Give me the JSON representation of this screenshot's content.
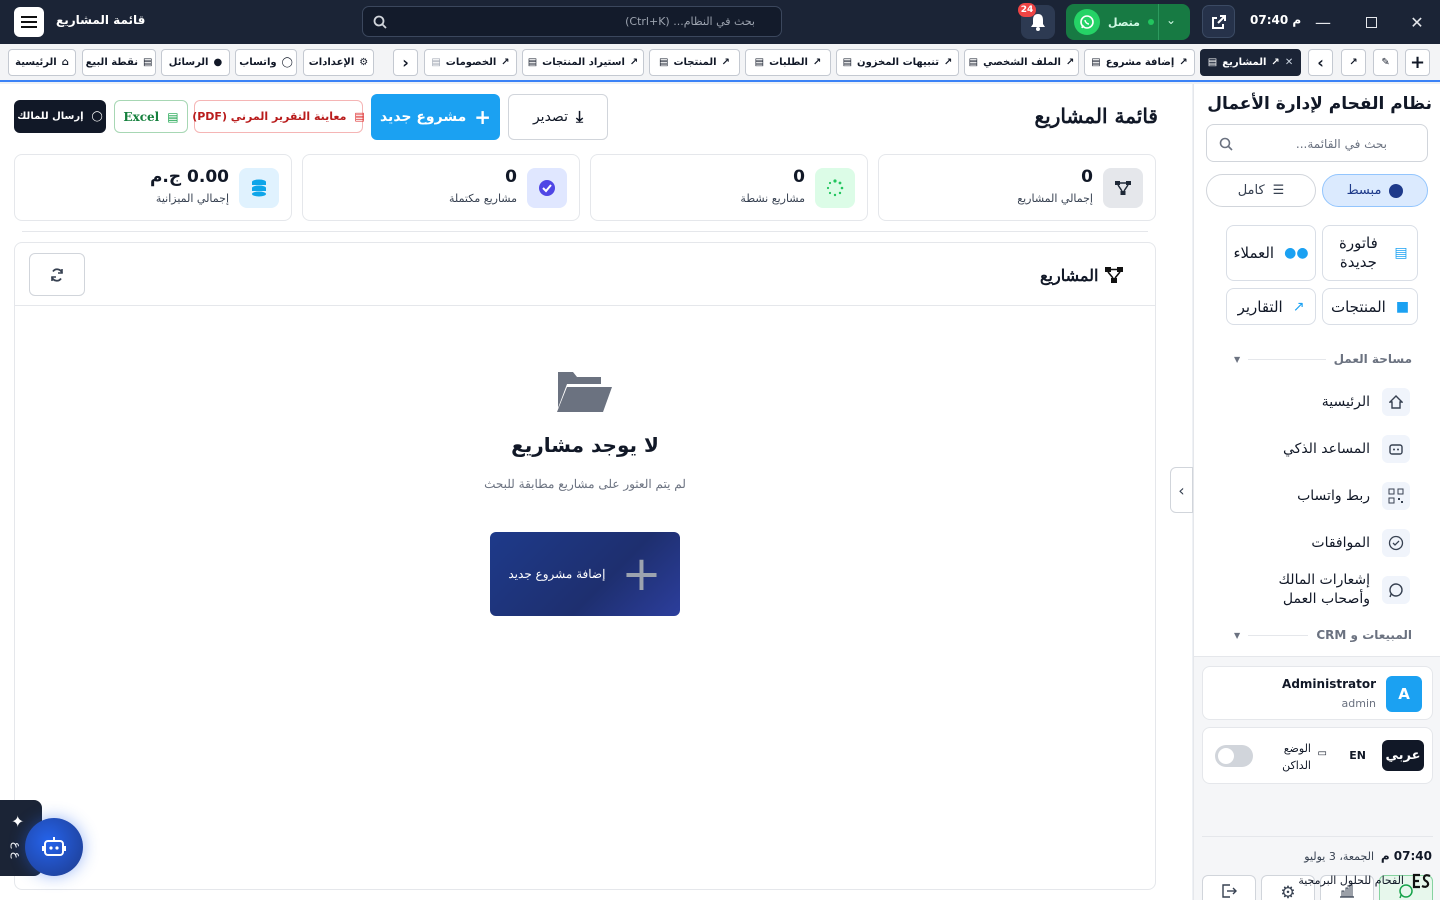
{
  "topbar": {
    "app_title": "قائمة المشاريع",
    "search_placeholder": "بحث في النظام... (Ctrl+K)",
    "notifications_count": "24",
    "whatsapp_status": "متصل",
    "time": "07:40 م"
  },
  "tabs": {
    "active": "المشاريع",
    "open_tabs": [
      "إضافة مشروع",
      "الملف الشخصي",
      "تنبيهات المخزون",
      "الطلبات",
      "المنتجات",
      "استيراد المنتجات",
      "الخصومات"
    ],
    "quick_links": [
      "الإعدادات",
      "واتساب",
      "الرسائل",
      "نقطة البيع",
      "الرئيسية"
    ]
  },
  "page": {
    "title": "قائمة المشاريع",
    "export_label": "تصدير",
    "new_project_label": "مشروع جديد",
    "pdf_label": "معاينة التقرير المرني (PDF)",
    "excel_label": "Excel",
    "send_owner_label": "إرسال للمالك"
  },
  "stats": [
    {
      "value": "0",
      "label": "إجمالي المشاريع",
      "icon": "diagram-icon",
      "color": "#374151",
      "bg": "#e5e7eb"
    },
    {
      "value": "0",
      "label": "مشاريع نشطة",
      "icon": "spinner-icon",
      "color": "#22c55e",
      "bg": "#dcfce7"
    },
    {
      "value": "0",
      "label": "مشاريع مكتملة",
      "icon": "check-circle-icon",
      "color": "#4f46e5",
      "bg": "#e0e7ff"
    },
    {
      "value": "0.00 ج.م",
      "label": "إجمالي الميزانية",
      "icon": "coins-icon",
      "color": "#0ea5e9",
      "bg": "#e0f2fe"
    }
  ],
  "list_section": {
    "title": "المشاريع",
    "empty_title": "لا يوجد مشاريع",
    "empty_subtitle": "لم يتم العثور على مشاريع مطابقة للبحث",
    "add_button": "إضافة مشروع جديد"
  },
  "sidebar": {
    "title": "نظام الفحام لإدارة الأعمال",
    "search_placeholder": "بحث في القائمة...",
    "mode_simple": "مبسط",
    "mode_full": "كامل",
    "quick_actions": [
      "فاتورة جديدة",
      "العملاء",
      "المنتجات",
      "التقارير"
    ],
    "section_workspace": "مساحة العمل",
    "nav_items": [
      "الرئيسية",
      "المساعد الذكي",
      "ربط واتساب",
      "الموافقات",
      "إشعارات المالك وأصحاب العمل"
    ],
    "section_sales": "المبيعات و CRM",
    "user_name": "Administrator",
    "user_role": "admin",
    "avatar_letter": "A",
    "lang_ar": "عربي",
    "lang_en": "EN",
    "dark_mode_label": "الوضع الداكن",
    "footer_time": "07:40 م",
    "footer_date": "الجمعة، 3 يوليو",
    "footer_company": "الفحام للحلول البرمجية"
  },
  "ai_widget": {
    "label": "ع ع"
  }
}
